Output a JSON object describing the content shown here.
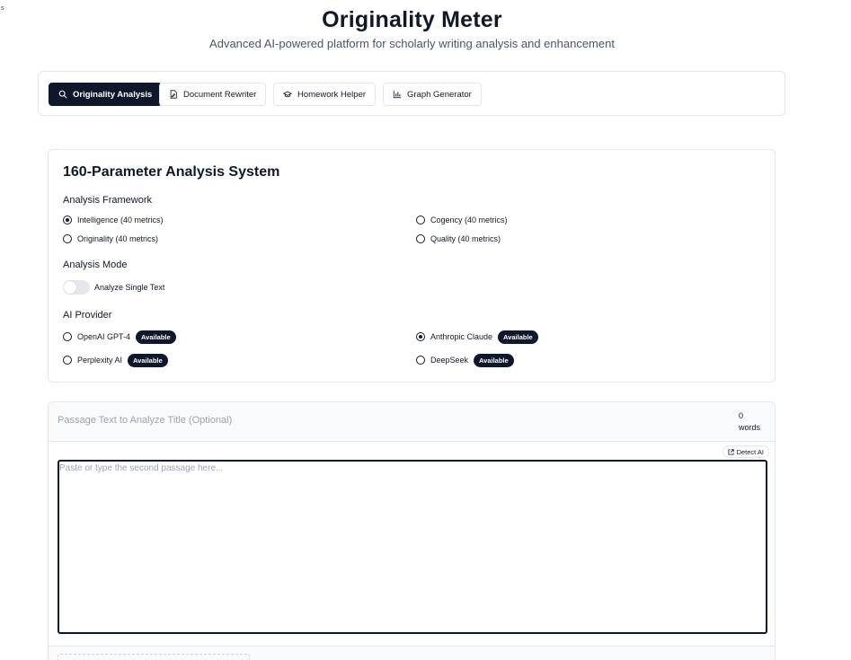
{
  "corner_mark": "s",
  "header": {
    "title": "Originality Meter",
    "subtitle": "Advanced AI-powered platform for scholarly writing analysis and enhancement"
  },
  "tabs": [
    {
      "label": "Originality Analysis",
      "icon": "search-icon",
      "active": true
    },
    {
      "label": "Document Rewriter",
      "icon": "file-edit-icon",
      "active": false
    },
    {
      "label": "Homework Helper",
      "icon": "graduation-cap-icon",
      "active": false
    },
    {
      "label": "Graph Generator",
      "icon": "bar-chart-icon",
      "active": false
    }
  ],
  "analysis_card": {
    "title": "160-Parameter Analysis System",
    "framework": {
      "label": "Analysis Framework",
      "options": [
        {
          "label": "Intelligence (40 metrics)",
          "checked": true
        },
        {
          "label": "Cogency (40 metrics)",
          "checked": false
        },
        {
          "label": "Originality (40 metrics)",
          "checked": false
        },
        {
          "label": "Quality (40 metrics)",
          "checked": false
        }
      ]
    },
    "mode": {
      "label": "Analysis Mode",
      "toggle_label": "Analyze Single Text",
      "toggle_on": false
    },
    "provider": {
      "label": "AI Provider",
      "options": [
        {
          "label": "OpenAI GPT-4",
          "badge": "Available",
          "checked": false
        },
        {
          "label": "Anthropic Claude",
          "badge": "Available",
          "checked": true
        },
        {
          "label": "Perplexity AI",
          "badge": "Available",
          "checked": false
        },
        {
          "label": "DeepSeek",
          "badge": "Available",
          "checked": false
        }
      ]
    }
  },
  "passage": {
    "title_placeholder": "Passage Text to Analyze Title (Optional)",
    "word_count": "0",
    "word_unit": "words",
    "detect_label": "Detect AI",
    "text_placeholder": "Paste or type the second passage here..."
  },
  "colors": {
    "primary": "#0f172a",
    "border": "#e5e7eb",
    "muted_text": "#9ca3af",
    "header_bg": "#f9fafb"
  }
}
